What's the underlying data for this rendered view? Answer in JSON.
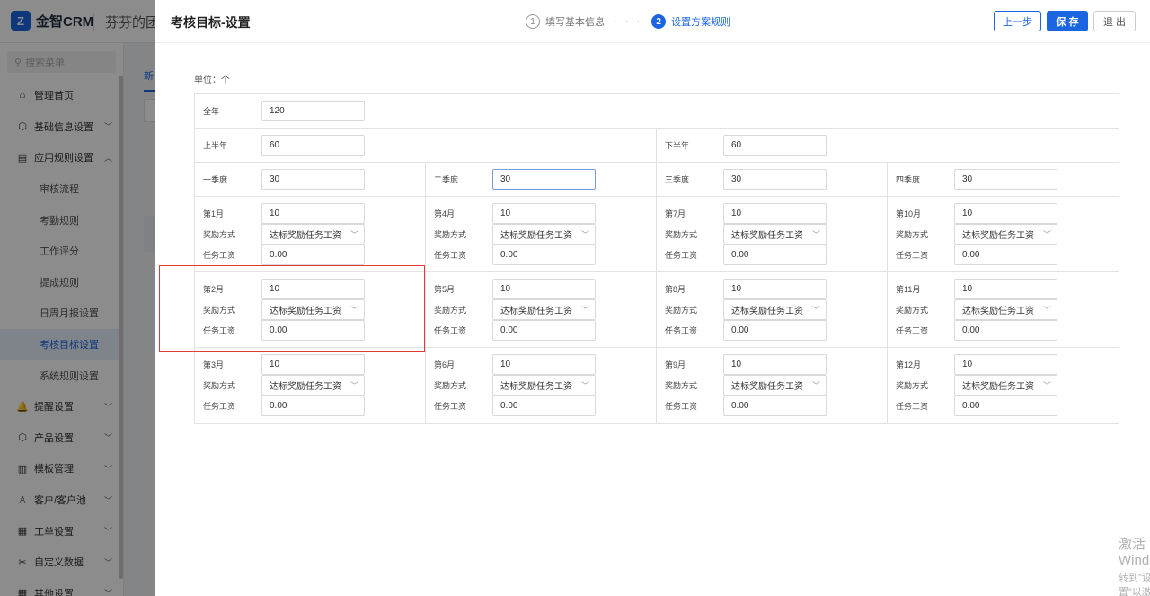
{
  "app": {
    "logo_mark": "Z",
    "name": "金智CRM",
    "team": "芬芬的团队"
  },
  "sidebar": {
    "search_placeholder": "搜索菜单",
    "items": [
      {
        "label": "管理首页",
        "icon": "home-icon",
        "glyph": "⌂"
      },
      {
        "label": "基础信息设置",
        "icon": "cube-icon",
        "glyph": "⬡",
        "chevron": "﹀"
      },
      {
        "label": "应用规则设置",
        "icon": "document-icon",
        "glyph": "▤",
        "chevron": "︿"
      },
      {
        "label": "审核流程",
        "sub": true
      },
      {
        "label": "考勤规则",
        "sub": true
      },
      {
        "label": "工作评分",
        "sub": true
      },
      {
        "label": "提成规则",
        "sub": true
      },
      {
        "label": "日周月报设置",
        "sub": true
      },
      {
        "label": "考核目标设置",
        "sub": true,
        "active": true
      },
      {
        "label": "系统规则设置",
        "sub": true
      },
      {
        "label": "提醒设置",
        "icon": "bell-icon",
        "glyph": "🔔",
        "chevron": "﹀"
      },
      {
        "label": "产品设置",
        "icon": "box-icon",
        "glyph": "⬡",
        "chevron": "﹀"
      },
      {
        "label": "模板管理",
        "icon": "template-icon",
        "glyph": "▥",
        "chevron": "﹀"
      },
      {
        "label": "客户/客户池",
        "icon": "user-icon",
        "glyph": "♙",
        "chevron": "﹀"
      },
      {
        "label": "工单设置",
        "icon": "ticket-icon",
        "glyph": "▦",
        "chevron": "﹀"
      },
      {
        "label": "自定义数据",
        "icon": "tools-icon",
        "glyph": "✂",
        "chevron": "﹀"
      },
      {
        "label": "其他设置",
        "icon": "grid-icon",
        "glyph": "▦",
        "chevron": "﹀"
      }
    ]
  },
  "main": {
    "tab_label": "新"
  },
  "drawer": {
    "title": "考核目标-设置",
    "steps": [
      {
        "num": "1",
        "label": "填写基本信息"
      },
      {
        "num": "2",
        "label": "设置方案规则"
      }
    ],
    "step_dots": "· · ·",
    "buttons": {
      "prev": "上一步",
      "save": "保 存",
      "exit": "退 出"
    },
    "unit_label": "单位：个",
    "year": {
      "label": "全年",
      "value": "120"
    },
    "halves": [
      {
        "label": "上半年",
        "value": "60"
      },
      {
        "label": "下半年",
        "value": "60"
      }
    ],
    "quarters": [
      {
        "label": "一季度",
        "value": "30"
      },
      {
        "label": "二季度",
        "value": "30"
      },
      {
        "label": "三季度",
        "value": "30"
      },
      {
        "label": "四季度",
        "value": "30"
      }
    ],
    "field_labels": {
      "reward_method": "奖励方式",
      "task_wage": "任务工资"
    },
    "month_rows": [
      [
        {
          "month": "第1月",
          "target": "10",
          "reward": "达标奖励任务工资",
          "wage": "0.00"
        },
        {
          "month": "第4月",
          "target": "10",
          "reward": "达标奖励任务工资",
          "wage": "0.00"
        },
        {
          "month": "第7月",
          "target": "10",
          "reward": "达标奖励任务工资",
          "wage": "0.00"
        },
        {
          "month": "第10月",
          "target": "10",
          "reward": "达标奖励任务工资",
          "wage": "0.00"
        }
      ],
      [
        {
          "month": "第2月",
          "target": "10",
          "reward": "达标奖励任务工资",
          "wage": "0.00"
        },
        {
          "month": "第5月",
          "target": "10",
          "reward": "达标奖励任务工资",
          "wage": "0.00"
        },
        {
          "month": "第8月",
          "target": "10",
          "reward": "达标奖励任务工资",
          "wage": "0.00"
        },
        {
          "month": "第11月",
          "target": "10",
          "reward": "达标奖励任务工资",
          "wage": "0.00"
        }
      ],
      [
        {
          "month": "第3月",
          "target": "10",
          "reward": "达标奖励任务工资",
          "wage": "0.00"
        },
        {
          "month": "第6月",
          "target": "10",
          "reward": "达标奖励任务工资",
          "wage": "0.00"
        },
        {
          "month": "第9月",
          "target": "10",
          "reward": "达标奖励任务工资",
          "wage": "0.00"
        },
        {
          "month": "第12月",
          "target": "10",
          "reward": "达标奖励任务工资",
          "wage": "0.00"
        }
      ]
    ]
  },
  "watermark": {
    "title": "激活 Windows",
    "subtitle": "转到\"设置\"以激活 Windows。"
  },
  "colors": {
    "accent": "#1a66e0",
    "highlight": "#e53935"
  }
}
